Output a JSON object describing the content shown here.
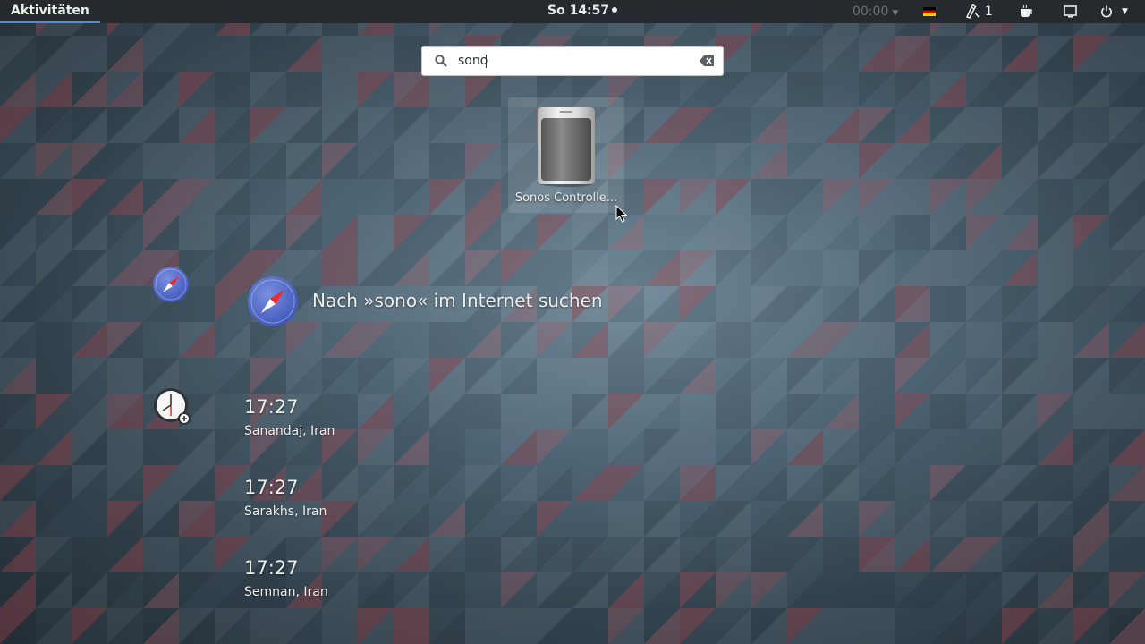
{
  "topbar": {
    "activities": "Aktivitäten",
    "clock": "So 14:57",
    "timer": "00:00",
    "keyboard_layout": "de",
    "accessibility_count": "1"
  },
  "search": {
    "value": "sono",
    "placeholder": ""
  },
  "app_results": [
    {
      "label": "Sonos Controlle...",
      "icon": "speaker-icon"
    }
  ],
  "web_search": {
    "label": "Nach »sono« im Internet suchen",
    "icon": "compass-icon"
  },
  "clock_results": [
    {
      "time": "17:27",
      "place": "Sanandaj, Iran"
    },
    {
      "time": "17:27",
      "place": "Sarakhs, Iran"
    },
    {
      "time": "17:27",
      "place": "Semnan, Iran"
    }
  ],
  "colors": {
    "topbar": "#242a2e",
    "accent": "#4a90d9",
    "text": "#eeeeec"
  }
}
